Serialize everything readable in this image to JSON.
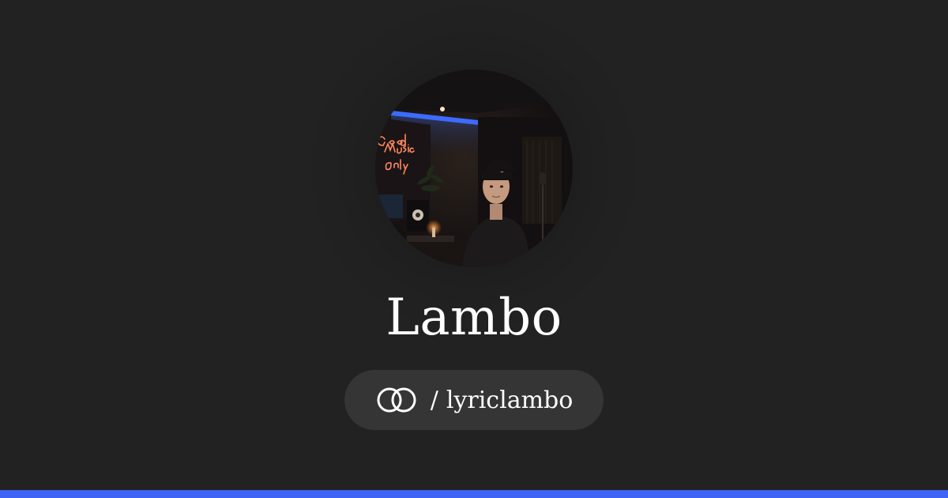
{
  "profile": {
    "name": "Lambo",
    "handle_separator": "/",
    "handle": "lyriclambo",
    "avatar_neon_sign": "Good Music Only"
  },
  "icons": {
    "link": "link-rings-icon"
  },
  "colors": {
    "background": "#232223",
    "pill": "#363536",
    "accent_bar": "#3f63f4",
    "text": "#ffffff",
    "neon": "#ff8a5c",
    "led": "#3d6bff"
  }
}
